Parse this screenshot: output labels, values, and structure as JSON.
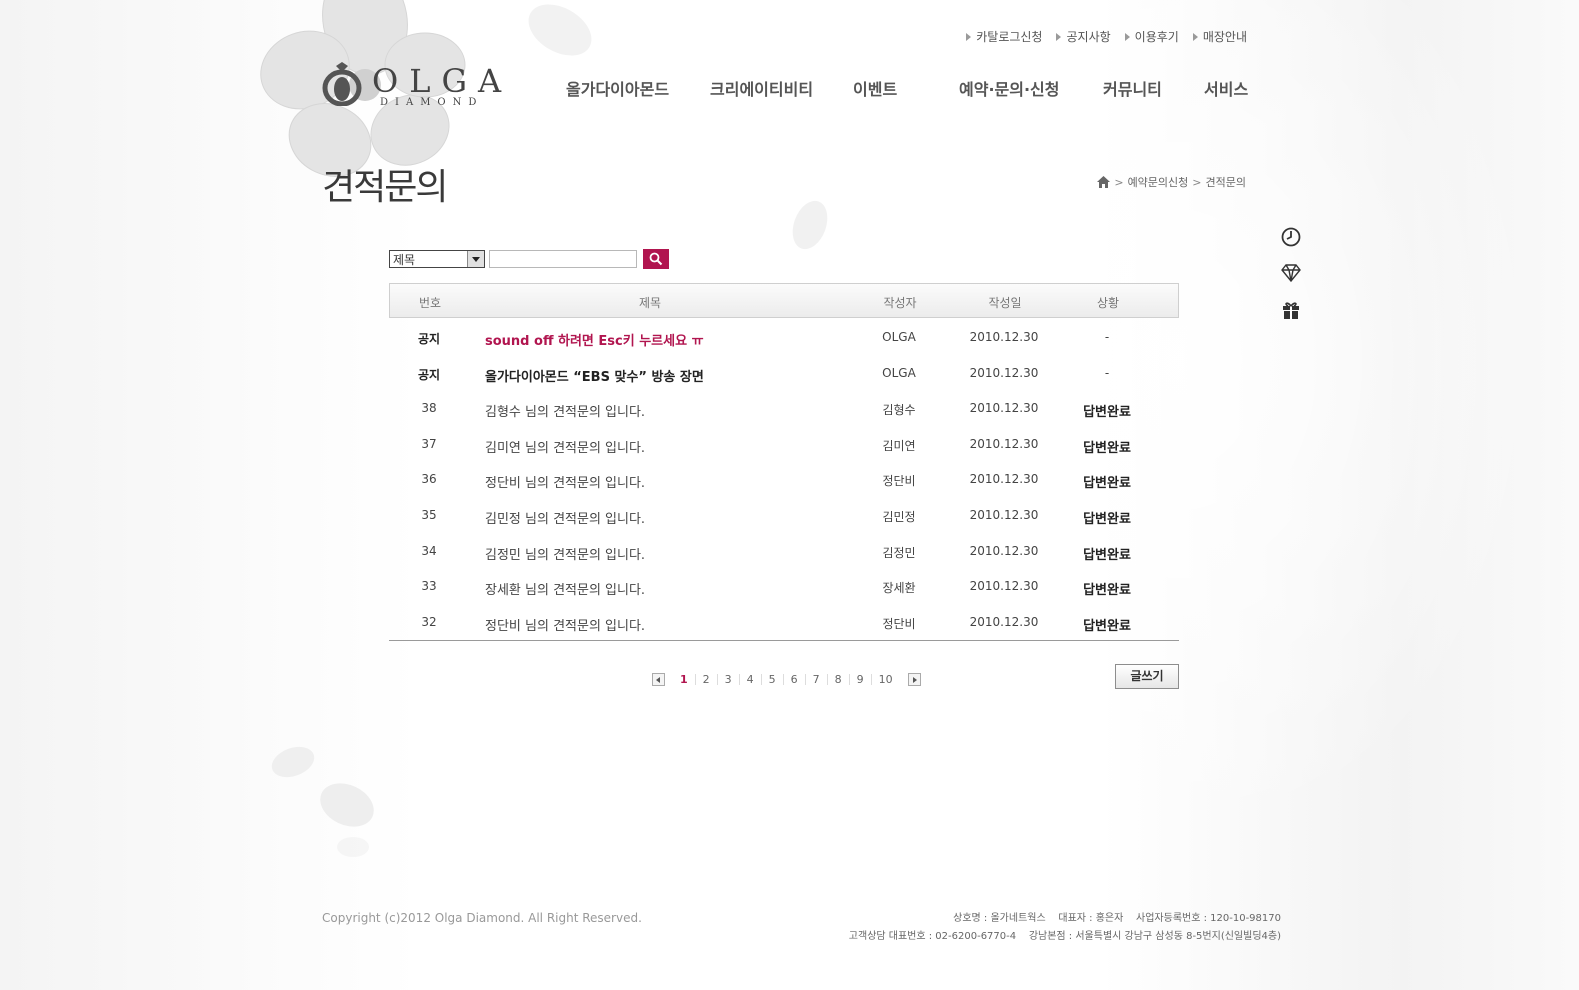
{
  "util_links": [
    "카탈로그신청",
    "공지사항",
    "이용후기",
    "매장안내"
  ],
  "logo": {
    "name": "OLGA",
    "sub": "DIAMOND"
  },
  "nav": [
    "올가다이아몬드",
    "크리에이티비티",
    "이벤트",
    "예약·문의·신청",
    "커뮤니티",
    "서비스"
  ],
  "page_title": "견적문의",
  "breadcrumb": {
    "level1": "예약문의신청",
    "level2": "견적문의"
  },
  "quick_icons": [
    "clock-icon",
    "diamond-icon",
    "gift-icon"
  ],
  "search": {
    "select_value": "제목",
    "input_value": "",
    "button_icon": "search-icon"
  },
  "table": {
    "headers": {
      "no": "번호",
      "title": "제목",
      "writer": "작성자",
      "date": "작성일",
      "status": "상황"
    },
    "rows": [
      {
        "no": "공지",
        "title": "sound off 하려면 Esc키 누르세요 ㅠ",
        "writer": "OLGA",
        "date": "2010.12.30",
        "status": "-"
      },
      {
        "no": "공지",
        "title": "올가다이아몬드 “EBS 맞수” 방송 장면",
        "writer": "OLGA",
        "date": "2010.12.30",
        "status": "-"
      },
      {
        "no": "38",
        "title": "김형수 님의 견적문의 입니다.",
        "writer": "김형수",
        "date": "2010.12.30",
        "status": "답변완료"
      },
      {
        "no": "37",
        "title": "김미연 님의 견적문의 입니다.",
        "writer": "김미연",
        "date": "2010.12.30",
        "status": "답변완료"
      },
      {
        "no": "36",
        "title": "정단비 님의 견적문의 입니다.",
        "writer": "정단비",
        "date": "2010.12.30",
        "status": "답변완료"
      },
      {
        "no": "35",
        "title": "김민정 님의 견적문의 입니다.",
        "writer": "김민정",
        "date": "2010.12.30",
        "status": "답변완료"
      },
      {
        "no": "34",
        "title": "김정민 님의 견적문의 입니다.",
        "writer": "김정민",
        "date": "2010.12.30",
        "status": "답변완료"
      },
      {
        "no": "33",
        "title": "장세환 님의 견적문의 입니다.",
        "writer": "장세환",
        "date": "2010.12.30",
        "status": "답변완료"
      },
      {
        "no": "32",
        "title": "정단비 님의 견적문의 입니다.",
        "writer": "정단비",
        "date": "2010.12.30",
        "status": "답변완료"
      }
    ]
  },
  "pagination": {
    "pages": [
      "1",
      "2",
      "3",
      "4",
      "5",
      "6",
      "7",
      "8",
      "9",
      "10"
    ],
    "current": "1"
  },
  "write_button": "글쓰기",
  "footer": {
    "copyright": "Copyright (c)2012 Olga Diamond. All Right Reserved.",
    "line1": "상호명 : 올가네트웍스    대표자 : 홍은자    사업자등록번호 : 120-10-98170",
    "line2": "고객상담 대표번호 : 02-6200-6770-4    강남본점 : 서울특별시 강남구 삼성동 8-5번지(신일빌딩4층)"
  },
  "colors": {
    "accent": "#b1154f",
    "text": "#333333",
    "muted": "#999999"
  }
}
